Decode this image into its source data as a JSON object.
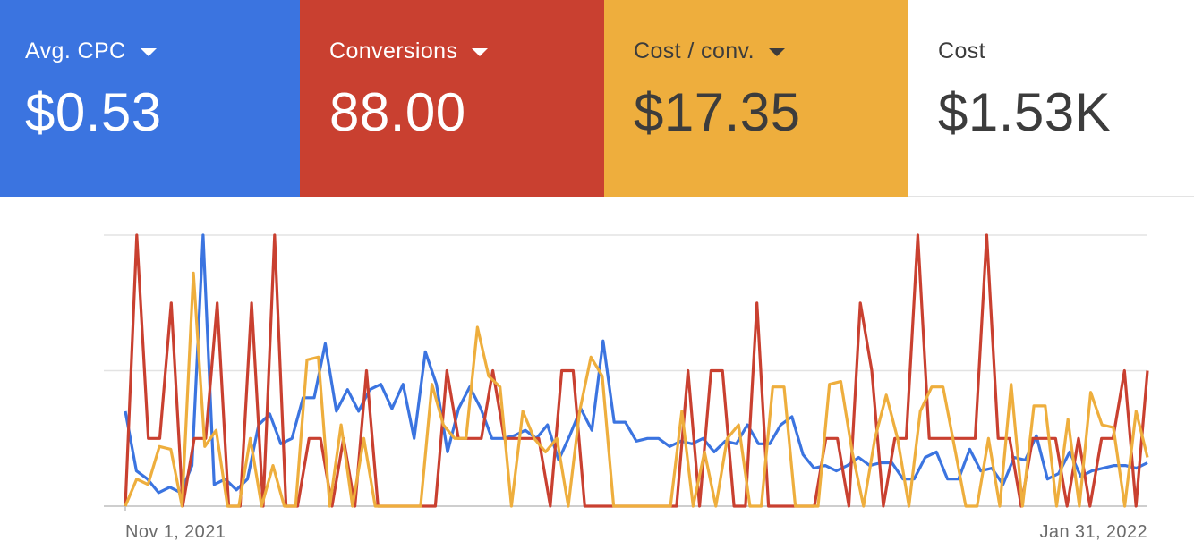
{
  "scorecards": [
    {
      "label": "Avg. CPC",
      "value": "$0.53",
      "color": "#3b74e0",
      "has_dropdown": true
    },
    {
      "label": "Conversions",
      "value": "88.00",
      "color": "#c94030",
      "has_dropdown": true
    },
    {
      "label": "Cost / conv.",
      "value": "$17.35",
      "color": "#eeae3d",
      "has_dropdown": true
    },
    {
      "label": "Cost",
      "value": "$1.53K",
      "color": "#ffffff",
      "has_dropdown": false
    }
  ],
  "chart_data": {
    "type": "line",
    "x_start_label": "Nov 1, 2021",
    "x_end_label": "Jan 31, 2022",
    "ylim": [
      0,
      1
    ],
    "grid": true,
    "series": [
      {
        "color": "#3b74e0",
        "values": [
          0.35,
          0.13,
          0.1,
          0.05,
          0.07,
          0.05,
          0.15,
          1.0,
          0.08,
          0.1,
          0.06,
          0.1,
          0.3,
          0.34,
          0.23,
          0.25,
          0.4,
          0.4,
          0.6,
          0.35,
          0.43,
          0.35,
          0.43,
          0.45,
          0.36,
          0.45,
          0.25,
          0.57,
          0.45,
          0.2,
          0.36,
          0.44,
          0.36,
          0.25,
          0.25,
          0.26,
          0.28,
          0.25,
          0.3,
          0.17,
          0.26,
          0.36,
          0.28,
          0.61,
          0.31,
          0.31,
          0.24,
          0.25,
          0.25,
          0.22,
          0.24,
          0.23,
          0.25,
          0.2,
          0.24,
          0.23,
          0.3,
          0.23,
          0.23,
          0.3,
          0.33,
          0.19,
          0.14,
          0.15,
          0.13,
          0.15,
          0.18,
          0.15,
          0.16,
          0.16,
          0.1,
          0.1,
          0.18,
          0.2,
          0.1,
          0.1,
          0.21,
          0.13,
          0.14,
          0.08,
          0.18,
          0.17,
          0.26,
          0.1,
          0.12,
          0.2,
          0.11,
          0.13,
          0.14,
          0.15,
          0.15,
          0.14,
          0.16
        ]
      },
      {
        "color": "#c94030",
        "values": [
          0.0,
          1.0,
          0.25,
          0.25,
          0.75,
          0.0,
          0.25,
          0.25,
          0.75,
          0.0,
          0.0,
          0.75,
          0.0,
          1.0,
          0.0,
          0.0,
          0.25,
          0.25,
          0.0,
          0.25,
          0.0,
          0.5,
          0.0,
          0.0,
          0.0,
          0.0,
          0.0,
          0.0,
          0.5,
          0.25,
          0.25,
          0.25,
          0.5,
          0.25,
          0.25,
          0.25,
          0.25,
          0.0,
          0.5,
          0.5,
          0.0,
          0.0,
          0.0,
          0.0,
          0.0,
          0.0,
          0.0,
          0.0,
          0.0,
          0.5,
          0.0,
          0.5,
          0.5,
          0.0,
          0.0,
          0.75,
          0.0,
          0.0,
          0.0,
          0.0,
          0.0,
          0.25,
          0.25,
          0.0,
          0.75,
          0.5,
          0.0,
          0.25,
          0.25,
          1.0,
          0.25,
          0.25,
          0.25,
          0.25,
          0.25,
          1.0,
          0.25,
          0.25,
          0.0,
          0.25,
          0.25,
          0.25,
          0.0,
          0.25,
          0.0,
          0.25,
          0.25,
          0.5,
          0.0,
          0.5
        ]
      },
      {
        "color": "#eeae3d",
        "values": [
          0.0,
          0.1,
          0.08,
          0.22,
          0.21,
          0.0,
          0.86,
          0.22,
          0.28,
          0.0,
          0.0,
          0.25,
          0.0,
          0.15,
          0.0,
          0.0,
          0.54,
          0.55,
          0.0,
          0.3,
          0.0,
          0.25,
          0.0,
          0.0,
          0.0,
          0.0,
          0.0,
          0.45,
          0.3,
          0.25,
          0.25,
          0.66,
          0.48,
          0.44,
          0.0,
          0.35,
          0.25,
          0.2,
          0.25,
          0.0,
          0.35,
          0.55,
          0.48,
          0.0,
          0.0,
          0.0,
          0.0,
          0.0,
          0.0,
          0.35,
          0.0,
          0.2,
          0.0,
          0.25,
          0.3,
          0.0,
          0.0,
          0.44,
          0.44,
          0.0,
          0.0,
          0.0,
          0.45,
          0.46,
          0.2,
          0.0,
          0.25,
          0.41,
          0.25,
          0.0,
          0.35,
          0.44,
          0.44,
          0.22,
          0.0,
          0.0,
          0.25,
          0.0,
          0.45,
          0.0,
          0.37,
          0.37,
          0.0,
          0.32,
          0.0,
          0.42,
          0.3,
          0.29,
          0.0,
          0.35,
          0.18
        ]
      }
    ]
  }
}
